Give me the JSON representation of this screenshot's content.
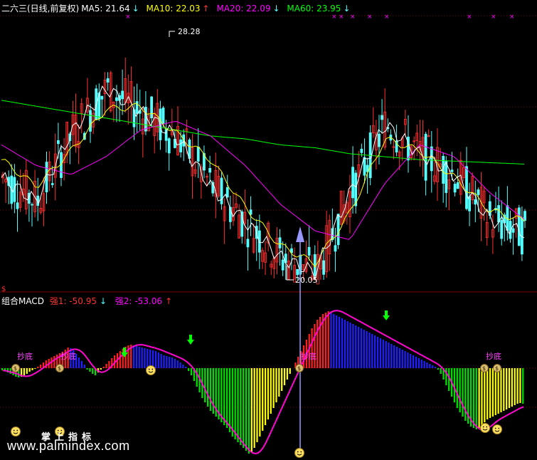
{
  "header": {
    "title": "二六三(日线,前复权)",
    "ma5": {
      "label": "MA5: 21.64",
      "arrow": "↓",
      "color": "#ffffff"
    },
    "ma10": {
      "label": "MA10: 22.03",
      "arrow": "↑",
      "color": "#ffff00"
    },
    "ma20": {
      "label": "MA20: 22.09",
      "arrow": "↓",
      "color": "#ff00ff"
    },
    "ma60": {
      "label": "MA60: 23.95",
      "arrow": "↓",
      "color": "#00ff00"
    }
  },
  "price_panel": {
    "high_label": "28.28",
    "low_label": "20.05"
  },
  "macd_panel": {
    "title": "组合MACD",
    "strong1": "强1: -50.95",
    "strong1_arrow": "↓",
    "strong2": "强2: -53.06",
    "strong2_arrow": "↑",
    "signal_label": "抄底",
    "axis_marker": "$"
  },
  "watermark": {
    "site": "www.palmindex.com",
    "brand": "掌上指标"
  },
  "colors": {
    "up": "#ff3030",
    "down": "#54ffff",
    "ma5": "#ffffff",
    "ma10": "#ffff00",
    "ma20": "#ff00ff",
    "ma60": "#00ff00",
    "macd_red": "#ff2020",
    "macd_blue": "#2020ff",
    "macd_yellow": "#ffff00",
    "macd_green": "#00e000",
    "arrow": "#9898ff",
    "grid": "#800000"
  },
  "chart_data": {
    "type": "line",
    "price_range": [
      20.05,
      28.28
    ],
    "price_series": {
      "ma60": [
        26.1,
        25.9,
        25.7,
        25.5,
        25.3,
        25.1,
        24.9,
        24.8,
        24.6,
        24.5,
        24.3,
        24.2,
        24.1,
        24.05,
        24.0,
        23.95
      ],
      "ma20": [
        24.6,
        23.9,
        23.6,
        24.2,
        25.1,
        25.4,
        24.9,
        23.9,
        22.6,
        21.7,
        21.4,
        23.3,
        24.6,
        24.2,
        23.0,
        22.09
      ],
      "ma10": [
        24.1,
        23.2,
        24.4,
        25.8,
        25.9,
        25.0,
        24.1,
        22.5,
        21.2,
        20.6,
        22.3,
        24.8,
        24.4,
        23.5,
        22.4,
        22.03
      ],
      "ma5": [
        23.5,
        22.7,
        25.0,
        26.5,
        25.7,
        24.9,
        23.2,
        22.0,
        20.8,
        20.3,
        23.0,
        25.3,
        24.3,
        23.6,
        22.1,
        21.64
      ]
    },
    "macd_histogram": [
      -3,
      -4,
      -6,
      -8,
      -10,
      -12,
      -13,
      -12,
      -10,
      -8,
      -5,
      -3,
      -1,
      2,
      5,
      8,
      11,
      13,
      15,
      17,
      19,
      21,
      23,
      26,
      29,
      28,
      25,
      20,
      15,
      10,
      5,
      -2,
      -5,
      -8,
      -10,
      -6,
      -2,
      2,
      6,
      10,
      14,
      18,
      21,
      24,
      27,
      30,
      32,
      33,
      32,
      31,
      30,
      29,
      28,
      27,
      26,
      25,
      24,
      22,
      20,
      18,
      17,
      16,
      15,
      13,
      11,
      8,
      5,
      2,
      -4,
      -10,
      -18,
      -26,
      -34,
      -42,
      -48,
      -54,
      -60,
      -64,
      -68,
      -72,
      -76,
      -80,
      -84,
      -90,
      -96,
      -100,
      -104,
      -108,
      -112,
      -116,
      -120,
      -118,
      -112,
      -104,
      -96,
      -88,
      -80,
      -72,
      -64,
      -56,
      -48,
      -40,
      -32,
      -24,
      -16,
      -8,
      0,
      8,
      16,
      24,
      32,
      40,
      48,
      56,
      62,
      68,
      72,
      76,
      78,
      80,
      78,
      76,
      74,
      72,
      70,
      68,
      66,
      64,
      62,
      60,
      58,
      56,
      54,
      52,
      50,
      48,
      46,
      44,
      42,
      40,
      38,
      36,
      34,
      32,
      30,
      28,
      26,
      24,
      22,
      20,
      18,
      16,
      14,
      12,
      10,
      8,
      6,
      4,
      2,
      -2,
      -8,
      -16,
      -24,
      -32,
      -40,
      -48,
      -56,
      -62,
      -68,
      -74,
      -78,
      -82,
      -84,
      -86,
      -84,
      -80,
      -76,
      -72,
      -70,
      -68,
      -66,
      -64,
      -62,
      -60,
      -58,
      -56,
      -54,
      -52,
      -50,
      -49,
      -50
    ],
    "strong_lines": {
      "strong1": -50.95,
      "strong2": -53.06
    }
  }
}
